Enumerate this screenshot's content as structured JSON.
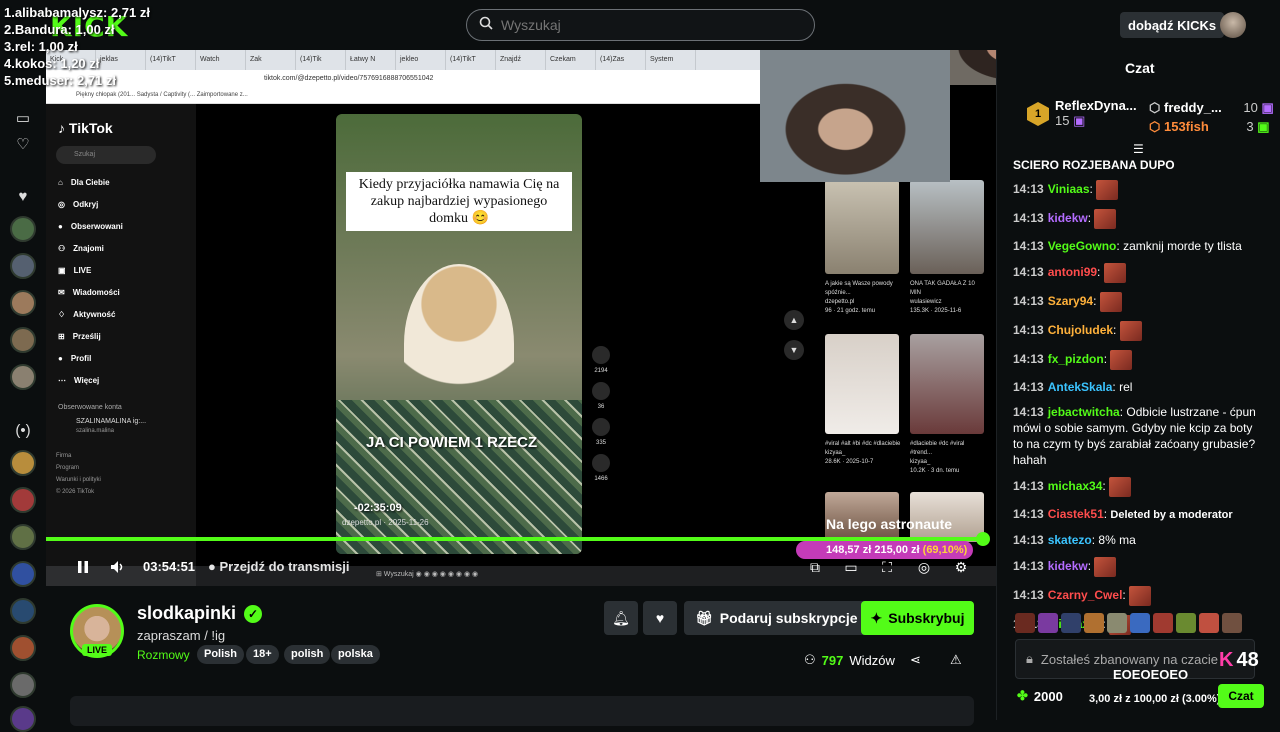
{
  "overlay": {
    "lines": [
      "1.alibabamalysz: 2,71 zł",
      "2.Bandura: 1,00 zł",
      "3.rel: 1,00 zł",
      "4.kokos: 1,20 zł",
      "5.meduser: 2,71 zł"
    ]
  },
  "header": {
    "search_placeholder": "Wyszukaj",
    "kicks_label": "dobądź KICKs"
  },
  "browser": {
    "tabs": [
      "Kick",
      "jeklas",
      "(14)TikT",
      "Watch",
      "Zak",
      "(14)Tik",
      "Łatwy N",
      "jekleo",
      "(14)TikT",
      "Znajdź",
      "Czekam",
      "(14)Zas",
      "System"
    ],
    "url": "tiktok.com/@dzepetto.pl/video/7576916888706551042",
    "bookmarks": "Piękny chłopak (201...   Sadysta / Captivity (...   Zaimportowane z..."
  },
  "tiktok": {
    "logo": "TikTok",
    "search": "Szukaj",
    "menu": [
      "Dla Ciebie",
      "Odkryj",
      "Obserwowani",
      "Znajomi",
      "LIVE",
      "Wiadomości",
      "Aktywność",
      "Prześlij",
      "Profil",
      "Więcej"
    ],
    "followed_title": "Obserwowane konta",
    "followed_name": "SZALINAMALINA ig:...",
    "followed_handle": "szalina.malina",
    "footer": [
      "Firma",
      "Program",
      "Warunki i polityki",
      "© 2026 TikTok"
    ],
    "caption": "Kiedy przyjaciółka namawia Cię na zakup najbardziej wypasionego domku 😊",
    "overlay_text": "JA CI POWIEM 1 RZECZ",
    "video_time": "-02:35:09",
    "author": "dzepetto.pl · 2025-11-26",
    "actions": [
      "2194",
      "36",
      "335",
      "1466"
    ],
    "thumbs": [
      {
        "title": "A jakie są Wasze powody spóźnie...",
        "author": "dzepetto.pl",
        "meta": "96 · 21 godz. temu"
      },
      {
        "title": "ONA TAK GADAŁA Z 10 MIN",
        "author": "wulasiewicz",
        "meta": "135.3K · 2025-11-6"
      },
      {
        "title": "#viral #alt #bi #dc #dlaciebie",
        "author": "kizyaa_",
        "meta": "28.6K · 2025-10-7"
      },
      {
        "title": "#dlaciebie #dc #viral #trend...",
        "author": "kizyaa_",
        "meta": "10.2K · 3 dn. temu"
      }
    ]
  },
  "stream": {
    "astronaut_text": "Na lego astronaute",
    "donation_amount": "148,57 zł",
    "donation_goal": "215,00 zł",
    "donation_pct": "(69,10%)",
    "timecode": "03:54:51",
    "go_live": "Przejdź do transmisji",
    "progress": 0.986
  },
  "channel": {
    "name": "slodkapinki",
    "title": "zapraszam / !ig",
    "category": "Rozmowy",
    "tags": [
      "Polish",
      "18+",
      "polish",
      "polska"
    ],
    "live": "LIVE",
    "gift_label": "Podaruj subskrypcje",
    "sub_label": "Subskrybuj",
    "viewer_count": "797",
    "viewer_label": "Widzów"
  },
  "chat": {
    "title": "Czat",
    "leaders": [
      {
        "rank": "1",
        "name": "ReflexDyna...",
        "count": "15"
      },
      {
        "name": "freddy_...",
        "count": "10"
      },
      {
        "name": "153fish",
        "count": "3"
      }
    ],
    "top_line": "SCIERO ROZJEBANA DUPO",
    "messages": [
      {
        "time": "14:13",
        "user": "Viniaas",
        "color": "#53fc18",
        "text": "",
        "emote": true
      },
      {
        "time": "14:13",
        "user": "kidekw",
        "color": "#b46cff",
        "text": "",
        "emote": true
      },
      {
        "time": "14:13",
        "user": "VegeGowno",
        "color": "#53fc18",
        "text": "zamknij morde ty tlista",
        "emote": false
      },
      {
        "time": "14:13",
        "user": "antoni99",
        "color": "#ff4d4d",
        "text": "",
        "emote": true
      },
      {
        "time": "14:13",
        "user": "Szary94",
        "color": "#ffb13b",
        "text": "",
        "emote": true
      },
      {
        "time": "14:13",
        "user": "Chujoludek",
        "color": "#ffb13b",
        "text": "",
        "emote": true
      },
      {
        "time": "14:13",
        "user": "fx_pizdon",
        "color": "#53fc18",
        "text": "",
        "emote": true
      },
      {
        "time": "14:13",
        "user": "AntekSkala",
        "color": "#3bc4ff",
        "text": "rel",
        "emote": false
      },
      {
        "time": "14:13",
        "user": "jebactwitcha",
        "color": "#53fc18",
        "text": "Odbicie lustrzane - ćpun mówi o sobie samym. Gdyby nie kcip za boty to na czym ty byś zarabiał zaćoany grubasie? hahah",
        "emote": false
      },
      {
        "time": "14:13",
        "user": "michax34",
        "color": "#53fc18",
        "text": "",
        "emote": true
      },
      {
        "time": "14:13",
        "user": "Ciastek51",
        "color": "#ff4d4d",
        "text": "Deleted by a moderator",
        "emote": false
      },
      {
        "time": "14:13",
        "user": "skatezo",
        "color": "#3bc4ff",
        "text": "8% ma",
        "emote": false
      },
      {
        "time": "14:13",
        "user": "kidekw",
        "color": "#b46cff",
        "text": "",
        "emote": true
      },
      {
        "time": "14:13",
        "user": "Czarny_Cwel",
        "color": "#ff4d4d",
        "text": "",
        "emote": true
      },
      {
        "time": "14:13",
        "user": "michax34",
        "color": "#53fc18",
        "text": "",
        "emote": true
      }
    ],
    "banned_text": "Zostałeś zbanowany na czacie",
    "ko_count": "48",
    "eoeo": "EOEOEOEO",
    "points": "2000",
    "goal_text": "3,00 zł z 100,00 zł (3.00%)",
    "chat_button": "Czat"
  }
}
